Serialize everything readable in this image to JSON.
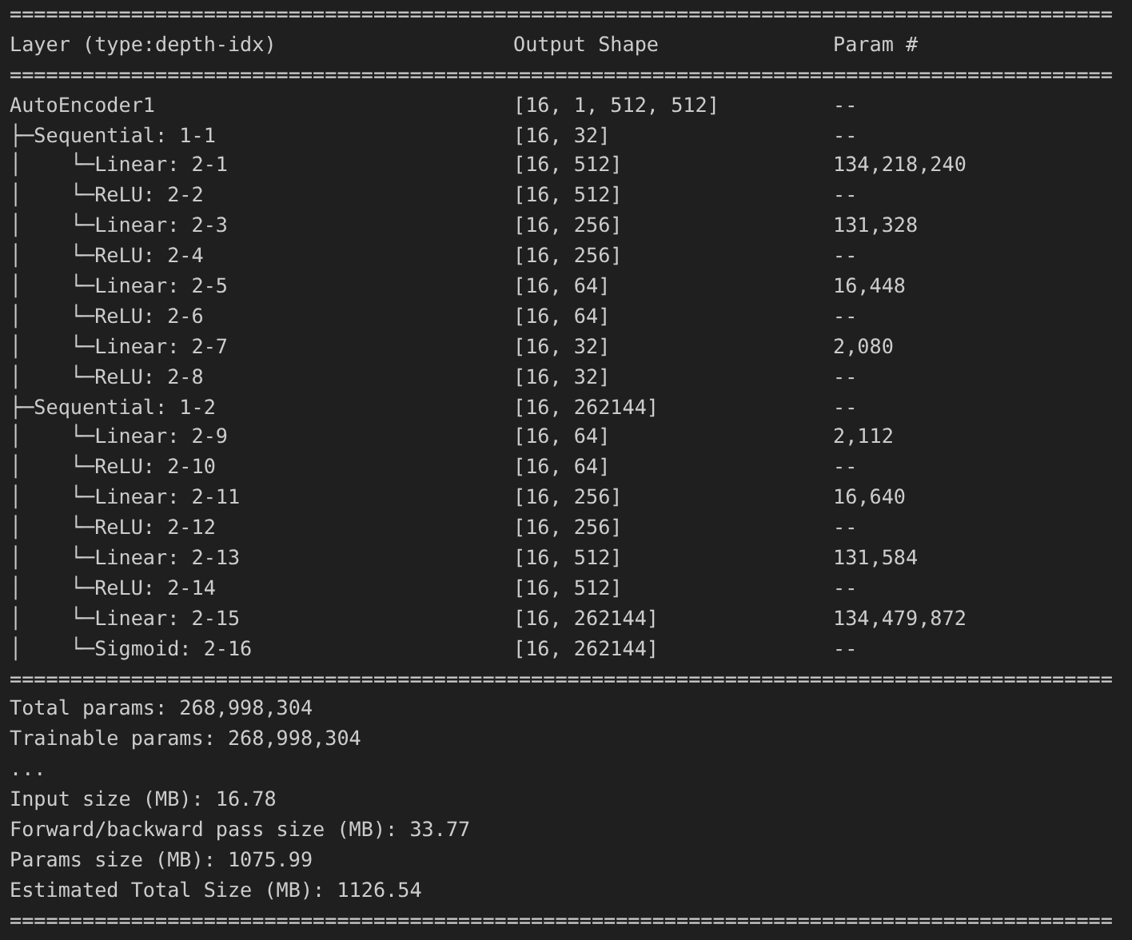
{
  "lines": [
    {
      "kind": "rule",
      "text": "==========================================================================================="
    },
    {
      "kind": "header",
      "cells": [
        "Layer (type:depth-idx)",
        "Output Shape",
        "Param #"
      ]
    },
    {
      "kind": "rule",
      "text": "==========================================================================================="
    },
    {
      "kind": "row",
      "cells": [
        "AutoEncoder1",
        "[16, 1, 512, 512]",
        "--"
      ]
    },
    {
      "kind": "row",
      "cells": [
        "├─Sequential: 1-1",
        "[16, 32]",
        "--"
      ]
    },
    {
      "kind": "row",
      "cells": [
        "│    └─Linear: 2-1",
        "[16, 512]",
        "134,218,240"
      ]
    },
    {
      "kind": "row",
      "cells": [
        "│    └─ReLU: 2-2",
        "[16, 512]",
        "--"
      ]
    },
    {
      "kind": "row",
      "cells": [
        "│    └─Linear: 2-3",
        "[16, 256]",
        "131,328"
      ]
    },
    {
      "kind": "row",
      "cells": [
        "│    └─ReLU: 2-4",
        "[16, 256]",
        "--"
      ]
    },
    {
      "kind": "row",
      "cells": [
        "│    └─Linear: 2-5",
        "[16, 64]",
        "16,448"
      ]
    },
    {
      "kind": "row",
      "cells": [
        "│    └─ReLU: 2-6",
        "[16, 64]",
        "--"
      ]
    },
    {
      "kind": "row",
      "cells": [
        "│    └─Linear: 2-7",
        "[16, 32]",
        "2,080"
      ]
    },
    {
      "kind": "row",
      "cells": [
        "│    └─ReLU: 2-8",
        "[16, 32]",
        "--"
      ]
    },
    {
      "kind": "row",
      "cells": [
        "├─Sequential: 1-2",
        "[16, 262144]",
        "--"
      ]
    },
    {
      "kind": "row",
      "cells": [
        "│    └─Linear: 2-9",
        "[16, 64]",
        "2,112"
      ]
    },
    {
      "kind": "row",
      "cells": [
        "│    └─ReLU: 2-10",
        "[16, 64]",
        "--"
      ]
    },
    {
      "kind": "row",
      "cells": [
        "│    └─Linear: 2-11",
        "[16, 256]",
        "16,640"
      ]
    },
    {
      "kind": "row",
      "cells": [
        "│    └─ReLU: 2-12",
        "[16, 256]",
        "--"
      ]
    },
    {
      "kind": "row",
      "cells": [
        "│    └─Linear: 2-13",
        "[16, 512]",
        "131,584"
      ]
    },
    {
      "kind": "row",
      "cells": [
        "│    └─ReLU: 2-14",
        "[16, 512]",
        "--"
      ]
    },
    {
      "kind": "row",
      "cells": [
        "│    └─Linear: 2-15",
        "[16, 262144]",
        "134,479,872"
      ]
    },
    {
      "kind": "row",
      "cells": [
        "│    └─Sigmoid: 2-16",
        "[16, 262144]",
        "--"
      ]
    },
    {
      "kind": "rule",
      "text": "==========================================================================================="
    },
    {
      "kind": "text",
      "text": "Total params: 268,998,304"
    },
    {
      "kind": "text",
      "text": "Trainable params: 268,998,304"
    },
    {
      "kind": "text",
      "text": "..."
    },
    {
      "kind": "text",
      "text": "Input size (MB): 16.78"
    },
    {
      "kind": "text",
      "text": "Forward/backward pass size (MB): 33.77"
    },
    {
      "kind": "text",
      "text": "Params size (MB): 1075.99"
    },
    {
      "kind": "text",
      "text": "Estimated Total Size (MB): 1126.54"
    },
    {
      "kind": "rule",
      "text": "==========================================================================================="
    }
  ]
}
